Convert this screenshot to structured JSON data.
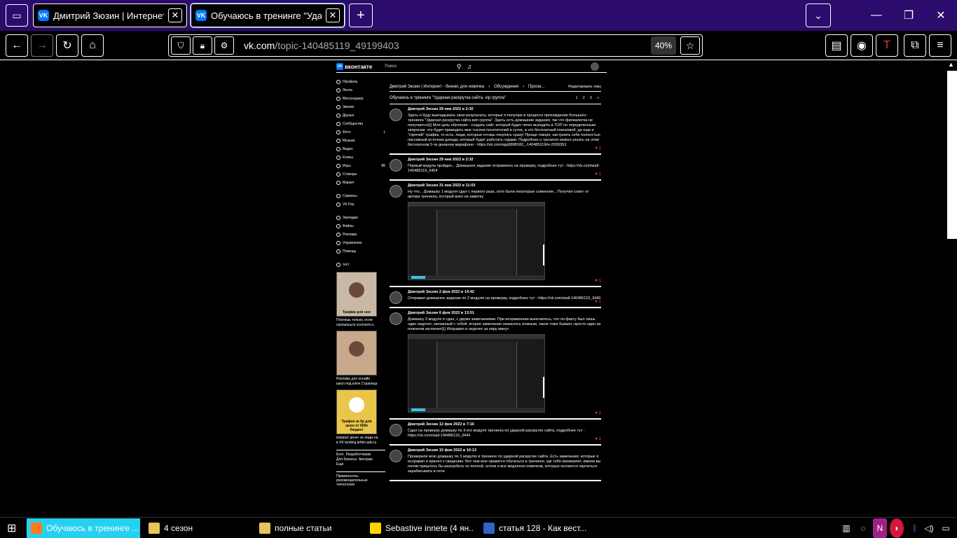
{
  "browser": {
    "tabs": [
      {
        "title": "Дмитрий Зюзин | Интернет -",
        "active": false
      },
      {
        "title": "Обучаюсь в тренинге \"Ударн",
        "active": true
      }
    ],
    "new_tab": "+",
    "url_host": "vk.com",
    "url_path": "/topic-140485119_49199403",
    "zoom": "40%"
  },
  "vk": {
    "logo": "вконтакте",
    "search_placeholder": "Поиск",
    "sidebar": [
      {
        "label": "Профиль",
        "count": ""
      },
      {
        "label": "Лента",
        "count": ""
      },
      {
        "label": "Мессенджер",
        "count": ""
      },
      {
        "label": "Звонки",
        "count": ""
      },
      {
        "label": "Друзья",
        "count": ""
      },
      {
        "label": "Сообщества",
        "count": ""
      },
      {
        "label": "Фото",
        "count": "1"
      },
      {
        "label": "Музыка",
        "count": ""
      },
      {
        "label": "Видео",
        "count": ""
      },
      {
        "label": "Клипы",
        "count": ""
      },
      {
        "label": "Игры",
        "count": "86"
      },
      {
        "label": "Стикеры",
        "count": ""
      },
      {
        "label": "Маркет",
        "count": ""
      }
    ],
    "sidebar2": [
      {
        "label": "Сервисы"
      },
      {
        "label": "VK Pay"
      }
    ],
    "sidebar3": [
      {
        "label": "Закладки"
      },
      {
        "label": "Файлы"
      },
      {
        "label": "Реклама"
      },
      {
        "label": "Управление"
      },
      {
        "label": "Помощь"
      }
    ],
    "sidebar4": [
      {
        "label": "тест"
      }
    ],
    "ads": [
      {
        "badge": "Трафик для онл",
        "caption": "Платишь только, если окупаешься vconvert.ru"
      },
      {
        "badge": "",
        "caption": "Реклама для онлайн школ под ключ Страница"
      },
      {
        "badge": "Трафик за 0р для школ от 500к бюджет",
        "caption": "вовзрат денег за лиды на в VK landing.artlim-ads.ru"
      }
    ],
    "footer_links": [
      "Блог",
      "Разработчикам",
      "Для бизнеса",
      "Авторам",
      "Ещё"
    ],
    "footer_note": "Применялось рекомендательные технологии",
    "breadcrumb": [
      "Дмитрий Зюзин | Интернет - бизнес для новичка",
      "Обсуждения",
      "Просм..."
    ],
    "edit_topic": "Редактировать тему",
    "topic_title": "Обучаюсь в тренинге \"Ударная раскрутка сайта. vip группа\"",
    "pages": "1 2 3 »",
    "posts": [
      {
        "author": "Дмитрий Зюзин 29 янв 2022 в 2:30",
        "text": "Здесь я буду выкладывать свои результаты, которые я получаю в процессе прохождения большого тренинга \"Ударная раскрутка сайта вип группа\". Здесь есть домашние задания, так что филиалитка не получается))) Моя цель обучения - создать сайт, который будет легко выходить в ТОП по определенным запросам, что будет приводить мне тысячи посетителей в сутки, а это бесплатный поисковой, да еще и \"горячий\" трафик, то есть, люди, которые готовы покупать сразу! Проще говоря, настроить себе полностью пассивный источник дохода, который будет работать годами. Подробнее о тренинге можно узнать на этом бесплатном 5-ти дневном марафоне - https://vk.com/app5898182_-140485119#s-2039353",
        "likes": "1",
        "has_image": false
      },
      {
        "author": "Дмитрий Зюзин 29 янв 2022 в 2:32",
        "text": "Первый модуль пройден... Домашнее задание отправлено на проверку, подробнее тут - https://vk.com/wall-140485119_3454",
        "likes": "1",
        "has_image": false
      },
      {
        "author": "Дмитрий Зюзин 31 янв 2022 в 11:03",
        "text": "Ну что... Домашку 1 модуля сдал с первого раза, хотя были некоторые сомнения... Получил совет от автора тренинга, который взял на заметку",
        "likes": "1",
        "has_image": true
      },
      {
        "author": "Дмитрий Зюзин 2 фев 2022 в 14:42",
        "text": "Отправил домашнее задание по 2 модулю на проверку, подробнее тут - https://vk.com/wall-140485119_3440",
        "likes": "1",
        "has_image": false
      },
      {
        "author": "Дмитрий Зюзин 6 фев 2022 в 13:51",
        "text": "Домашку 2 модуля я сдал, с двумя замечаниями. При исправлении выяснилось, что по факту был лишь один недочет, связанный с тобой, второе замечание оказалось ложным, такое тоже бывает, просто один из плагинов заглючил))) Исправил и недочет за пару минут",
        "likes": "1",
        "has_image": true
      },
      {
        "author": "Дмитрий Зюзин 12 фев 2022 в 7:16",
        "text": "Сдал на проверку домашку по 3-его модуля тренинга по ударной раскрутке сайта, подробнее тут - https://vk.com/wall-140485119_3444",
        "likes": "1",
        "has_image": false
      },
      {
        "author": "Дмитрий Зюзин 15 фев 2022 в 10:13",
        "text": "Проверили мою домашку по 3 модулю в тренинге по ударной раскрутке сайта. Есть замечания, которые я исправил и принял к сведению. Вот чем мне нравится обучаться в тренинге, где тебя проверяют, имеем вы потом пришлось бы разгребать по полной, оптом и все медленно новичков, которые пытаются научиться зарабатывать в сети",
        "likes": "",
        "has_image": false
      }
    ]
  },
  "taskbar": [
    {
      "label": "Обучаюсь в тренинге ...",
      "color": "#ff7a1a",
      "active": true
    },
    {
      "label": "4 сезон",
      "color": "#e8c35a",
      "active": false
    },
    {
      "label": "полные статьи",
      "color": "#e8c35a",
      "active": false
    },
    {
      "label": "Sebastive innete (4 ян...",
      "color": "#ffd400",
      "active": false
    },
    {
      "label": "статья 128 - Как вест...",
      "color": "#2b66c7",
      "active": false
    }
  ],
  "colors": {
    "tabbar": "#2b0b6b",
    "vk_blue": "#0077ff",
    "like_red": "#e64646",
    "taskbar_active": "#28d0f0"
  }
}
